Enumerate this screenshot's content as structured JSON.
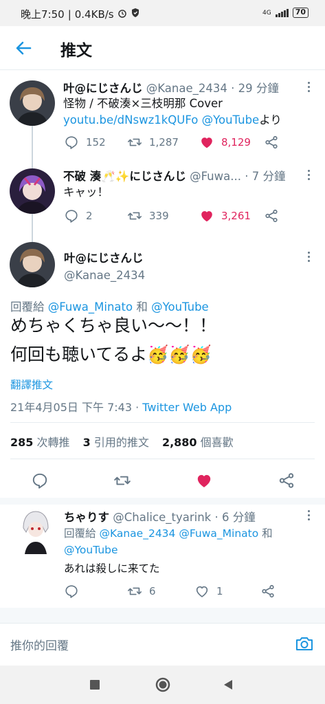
{
  "status_bar": {
    "time": "晚上7:50",
    "speed": "0.4KB/s",
    "network": "4G",
    "battery": "70"
  },
  "header": {
    "title": "推文"
  },
  "tweets": [
    {
      "name": "叶@にじさんじ",
      "handle": "@Kanae_2434",
      "time": "· 29 分鐘",
      "text_prefix": "怪物 / 不破湊×三枝明那 Cover ",
      "text_link": "youtu.be/dNswz1kQUFo",
      "text_mention": "@YouTube",
      "text_suffix": "より",
      "replies": "152",
      "retweets": "1,287",
      "likes": "8,129"
    },
    {
      "name": "不破 湊🥂✨にじさんじ",
      "handle": "@Fuwa...",
      "time": "· 7 分鐘",
      "text": "キャッ！",
      "replies": "2",
      "retweets": "339",
      "likes": "3,261"
    }
  ],
  "main_tweet": {
    "name": "叶@にじさんじ",
    "handle": "@Kanae_2434",
    "reply_to_label": "回覆給",
    "reply_to_1": "@Fuwa_Minato",
    "reply_and": "和",
    "reply_to_2": "@YouTube",
    "line1": "めちゃくちゃ良い〜〜！！",
    "line2": "何回も聴いてるよ🥳🥳🥳",
    "translate": "翻譯推文",
    "timestamp": "21年4月05日 下午 7:43 ·",
    "source": "Twitter Web App",
    "retweet_count": "285",
    "retweet_label": "次轉推",
    "quote_count": "3",
    "quote_label": "引用的推文",
    "like_count": "2,880",
    "like_label": "個喜歡"
  },
  "reply_tweet": {
    "name": "ちゃりす",
    "handle": "@Chalice_tyarink",
    "time": "· 6 分鐘",
    "reply_to_label": "回覆給",
    "reply_to_1": "@Kanae_2434",
    "reply_to_2": "@Fuwa_Minato",
    "reply_and": "和",
    "reply_to_3": "@YouTube",
    "text": "あれは殺しに来てた",
    "retweets": "6",
    "likes": "1"
  },
  "reply_bar": {
    "placeholder": "推你的回覆"
  },
  "colors": {
    "accent": "#1b95e0",
    "like": "#e0245e",
    "muted": "#657786"
  }
}
